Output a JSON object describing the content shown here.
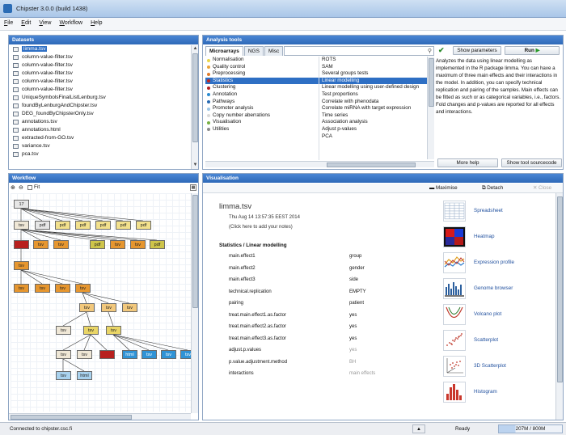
{
  "window": {
    "title": "Chipster 3.0.0 (build 1438)"
  },
  "menu": [
    "File",
    "Edit",
    "View",
    "Workflow",
    "Help"
  ],
  "datasets": {
    "header": "Datasets",
    "items": [
      {
        "name": "limma.tsv",
        "selected": true
      },
      {
        "name": "column-value-filter.tsv"
      },
      {
        "name": "column-value-filter.tsv"
      },
      {
        "name": "column-value-filter.tsv"
      },
      {
        "name": "column-value-filter.tsv"
      },
      {
        "name": "column-value-filter.tsv"
      },
      {
        "name": "UniqueSymbolsFinalListLenburg.tsv"
      },
      {
        "name": "foundByLenburgAndChipster.tsv"
      },
      {
        "name": "DEG_foundByChipsterOnly.tsv"
      },
      {
        "name": "annotations.tsv"
      },
      {
        "name": "annotations.html"
      },
      {
        "name": "extracted-from-GO.tsv"
      },
      {
        "name": "variance.tsv"
      },
      {
        "name": "pca.tsv"
      }
    ]
  },
  "analysis": {
    "header": "Analysis tools",
    "tabs": [
      "Microarrays",
      "NGS",
      "Misc"
    ],
    "categories": [
      {
        "name": "Normalisation",
        "color": "#e9d64a"
      },
      {
        "name": "Quality control",
        "color": "#e9a43a"
      },
      {
        "name": "Preprocessing",
        "color": "#e07b2c"
      },
      {
        "name": "Statistics",
        "color": "#c0281f",
        "selected": true
      },
      {
        "name": "Clustering",
        "color": "#b52020"
      },
      {
        "name": "Annotation",
        "color": "#2a8ad0"
      },
      {
        "name": "Pathways",
        "color": "#2569b3"
      },
      {
        "name": "Promoter analysis",
        "color": "#9cc6e6"
      },
      {
        "name": "Copy number aberrations",
        "color": "#d9d9d9"
      },
      {
        "name": "Visualisation",
        "color": "#76b043"
      },
      {
        "name": "Utilities",
        "color": "#8a8a8a"
      }
    ],
    "tools": [
      {
        "name": "ROTS"
      },
      {
        "name": "SAM"
      },
      {
        "name": "Several groups tests"
      },
      {
        "name": "Linear modelling",
        "selected": true
      },
      {
        "name": "Linear modelling using user-defined design"
      },
      {
        "name": "Test proportions"
      },
      {
        "name": "Correlate with phenodata"
      },
      {
        "name": "Correlate miRNA with target expression"
      },
      {
        "name": "Time series"
      },
      {
        "name": "Association analysis"
      },
      {
        "name": "Adjust p-values"
      },
      {
        "name": "PCA"
      }
    ],
    "show_parameters_label": "Show parameters",
    "run_label": "Run",
    "description": "Analyzes the data using linear modelling as implemented in the R package limma. You can have a maximum of three main effects and their interactions in the model. In addition, you can specify technical replication and pairing of the samples. Main effects can be fitted as such or as categorical variables, i.e., factors. Fold changes and p-values are reported for all effects and interactions.",
    "more_help_label": "More help",
    "sourcecode_label": "Show tool sourcecode"
  },
  "workflow": {
    "header": "Workflow",
    "fit_label": "Fit",
    "nodes": [
      {
        "label": "17",
        "cls": "n-gray"
      },
      {
        "label": "tsv",
        "cls": "n-beige"
      },
      {
        "label": "pdf",
        "cls": "n-gray"
      },
      {
        "label": "pdf",
        "cls": "n-yellow"
      },
      {
        "label": "pdf",
        "cls": "n-yellow"
      },
      {
        "label": "pdf",
        "cls": "n-yellow"
      },
      {
        "label": "pdf",
        "cls": "n-yellow"
      },
      {
        "label": "pdf",
        "cls": "n-yellow"
      },
      {
        "label": "",
        "cls": "n-red"
      },
      {
        "label": "tsv",
        "cls": "n-orange"
      },
      {
        "label": "tsv",
        "cls": "n-orange"
      },
      {
        "label": "tsv",
        "cls": "n-orange"
      },
      {
        "label": "tsv",
        "cls": "n-orange"
      },
      {
        "label": "pdf",
        "cls": "n-olive"
      },
      {
        "label": "pdf",
        "cls": "n-olive"
      },
      {
        "label": "tsv",
        "cls": "n-orange"
      },
      {
        "label": "tsv",
        "cls": "n-orange"
      },
      {
        "label": "tsv",
        "cls": "n-orange"
      },
      {
        "label": "tsv",
        "cls": "n-orange"
      },
      {
        "label": "tsv",
        "cls": "n-orange"
      },
      {
        "label": "tsv",
        "cls": "n-orange"
      },
      {
        "label": "tsv",
        "cls": "n-lorange"
      },
      {
        "label": "tsv",
        "cls": "n-lorange"
      },
      {
        "label": "tsv",
        "cls": "n-lorange"
      },
      {
        "label": "tsv",
        "cls": "n-beige"
      },
      {
        "label": "tsv",
        "cls": "n-yel2"
      },
      {
        "label": "tsv",
        "cls": "n-yel2"
      },
      {
        "label": "tsv",
        "cls": "n-beige"
      },
      {
        "label": "tsv",
        "cls": "n-beige"
      },
      {
        "label": "",
        "cls": "n-red"
      },
      {
        "label": "html",
        "cls": "n-blue"
      },
      {
        "label": "tsv",
        "cls": "n-blue"
      },
      {
        "label": "tsv",
        "cls": "n-blue"
      },
      {
        "label": "tsv",
        "cls": "n-blue"
      },
      {
        "label": "tsv",
        "cls": "n-lblue"
      },
      {
        "label": "html",
        "cls": "n-lblue"
      }
    ]
  },
  "visualisation": {
    "header": "Visualisation",
    "maximise_label": "Maximise",
    "detach_label": "Detach",
    "close_label": "Close",
    "dataset_name": "limma.tsv",
    "date": "Thu Aug 14 13:57:35 EEST 2014",
    "notes_hint": "(Click here to add your notes)",
    "operation": "Statistics / Linear modelling",
    "params": [
      {
        "name": "main.effect1",
        "value": "group"
      },
      {
        "name": "main.effect2",
        "value": "gender"
      },
      {
        "name": "main.effect3",
        "value": "side"
      },
      {
        "name": "technical.replication",
        "value": "EMPTY"
      },
      {
        "name": "pairing",
        "value": "patient"
      },
      {
        "name": "treat.main.effect1.as.factor",
        "value": "yes"
      },
      {
        "name": "treat.main.effect2.as.factor",
        "value": "yes"
      },
      {
        "name": "treat.main.effect3.as.factor",
        "value": "yes"
      },
      {
        "name": "adjust.p.values",
        "value": "yes",
        "muted": true
      },
      {
        "name": "p.value.adjustment.method",
        "value": "BH",
        "muted": true
      },
      {
        "name": "interactions",
        "value": "main effects",
        "muted": true
      }
    ],
    "methods": [
      {
        "label": "Spreadsheet",
        "icon": "spreadsheet-icon"
      },
      {
        "label": "Heatmap",
        "icon": "heatmap-icon"
      },
      {
        "label": "Expression profile",
        "icon": "expression-profile-icon"
      },
      {
        "label": "Genome browser",
        "icon": "genome-browser-icon"
      },
      {
        "label": "Volcano plot",
        "icon": "volcano-plot-icon"
      },
      {
        "label": "Scatterplot",
        "icon": "scatterplot-icon"
      },
      {
        "label": "3D Scatterplot",
        "icon": "scatterplot-3d-icon"
      },
      {
        "label": "Histogram",
        "icon": "histogram-icon"
      }
    ]
  },
  "status": {
    "connection": "Connected to chipster.csc.fi",
    "state": "Ready",
    "memory": "207M / 800M"
  }
}
